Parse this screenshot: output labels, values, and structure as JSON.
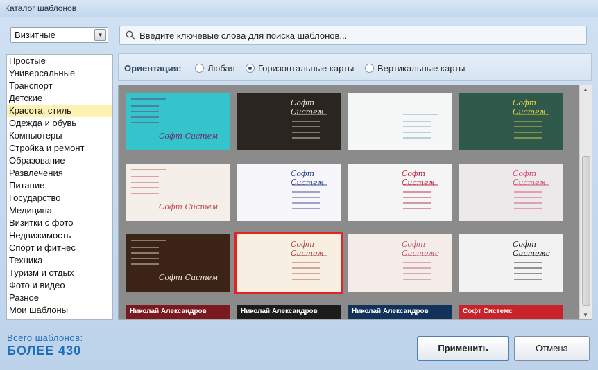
{
  "window": {
    "title": "Каталог шаблонов"
  },
  "category_select": {
    "value": "Визитные"
  },
  "search": {
    "placeholder": "Введите ключевые слова для поиска шаблонов..."
  },
  "sidebar": {
    "items": [
      "Простые",
      "Универсальные",
      "Транспорт",
      "Детские",
      "Красота, стиль",
      "Одежда и обувь",
      "Компьютеры",
      "Стройка и ремонт",
      "Образование",
      "Развлечения",
      "Питание",
      "Государство",
      "Медицина",
      "Визитки с фото",
      "Недвижимость",
      "Спорт и фитнес",
      "Техника",
      "Туризм и отдых",
      "Фото и видео",
      "Разное",
      "Мои шаблоны"
    ],
    "selected_index": 4
  },
  "orientation": {
    "label": "Ориентация:",
    "options": [
      "Любая",
      "Горизонтальные карты",
      "Вертикальные карты"
    ],
    "selected_index": 1
  },
  "templates": {
    "selected_index": 9,
    "cards": [
      {
        "name": "Софт Систем",
        "bg": "#35c4cc",
        "fg": "#6a2d6d"
      },
      {
        "name": "Софт Систем",
        "bg": "#2a2520",
        "fg": "#f2e6cc"
      },
      {
        "name": "",
        "bg": "#f6f7f7",
        "fg": "#6fa7a8"
      },
      {
        "name": "Софт Систем",
        "bg": "#2f5a4b",
        "fg": "#f4d43e"
      },
      {
        "name": "Софт Систем",
        "bg": "#f4efe9",
        "fg": "#c2474f"
      },
      {
        "name": "Софт Систем",
        "bg": "#f7f7fb",
        "fg": "#2a3f8c"
      },
      {
        "name": "Софт Систем",
        "bg": "#f5f5f5",
        "fg": "#b8223f"
      },
      {
        "name": "Софт Систем",
        "bg": "#ece9eb",
        "fg": "#d14a6a"
      },
      {
        "name": "Софт Систем",
        "bg": "#3b2416",
        "fg": "#f3e7d3"
      },
      {
        "name": "Софт Систем",
        "bg": "#f7f0e2",
        "fg": "#b0443a"
      },
      {
        "name": "Софт Системс",
        "bg": "#f4ece9",
        "fg": "#c1566b"
      },
      {
        "name": "Софт Системс",
        "bg": "#f2f2f2",
        "fg": "#1f1f1f"
      },
      {
        "name": "Николай Александров",
        "bg": "#7a1a1f",
        "fg": "#ffffff"
      },
      {
        "name": "Николай Александров",
        "bg": "#1c1c1c",
        "fg": "#ffffff"
      },
      {
        "name": "Николай Александров",
        "bg": "#12325a",
        "fg": "#ffffff"
      },
      {
        "name": "Софт Системс",
        "bg": "#c8222a",
        "fg": "#ffffff"
      }
    ]
  },
  "footer": {
    "total_label": "Всего шаблонов:",
    "total_value": "БОЛЕЕ 430",
    "apply_label": "Применить",
    "cancel_label": "Отмена"
  }
}
